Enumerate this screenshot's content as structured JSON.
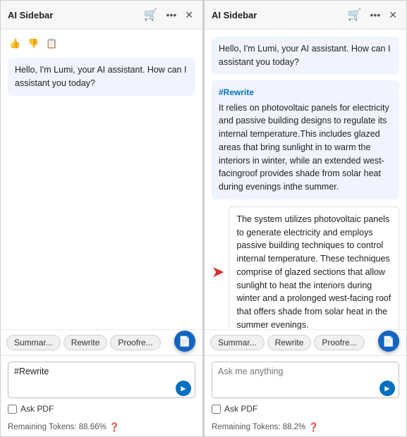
{
  "panels": [
    {
      "id": "left",
      "header": {
        "title": "AI Sidebar",
        "cart_icon": "🛒",
        "more_icon": "⋯",
        "close_icon": "✕"
      },
      "messages": [
        {
          "type": "ai-greeting",
          "text": "Hello, I'm Lumi, your AI assistant. How can I assistant you today?"
        }
      ],
      "quick_actions": [
        {
          "label": "Summar..."
        },
        {
          "label": "Rewrite"
        },
        {
          "label": "Proofre..."
        }
      ],
      "input": {
        "value": "#Rewrite\n",
        "placeholder": "Ask me anything"
      },
      "ask_pdf_label": "Ask PDF",
      "tokens_label": "Remaining Tokens: 88.66%"
    },
    {
      "id": "right",
      "header": {
        "title": "AI Sidebar",
        "cart_icon": "🛒",
        "more_icon": "⋯",
        "close_icon": "✕"
      },
      "messages": [
        {
          "type": "ai-greeting",
          "text": "Hello, I'm Lumi, your AI assistant. How can I assistant you today?"
        },
        {
          "type": "rewrite-original",
          "tag": "#Rewrite",
          "text": "It relies on photovoltaic panels for electricity and passive building designs to regulate its internal temperature.This includes glazed areas that bring sunlight in to warm the interiors in winter, while an extended west-facingroof provides shade from solar heat during evenings inthe summer."
        },
        {
          "type": "rewrite-result",
          "text": "The system utilizes photovoltaic panels to generate electricity and employs passive building techniques to control internal temperature. These techniques comprise of glazed sections that allow sunlight to heat the interiors during winter and a prolonged west-facing roof that offers shade from solar heat in the summer evenings."
        }
      ],
      "quick_actions": [
        {
          "label": "Summar..."
        },
        {
          "label": "Rewrite"
        },
        {
          "label": "Proofre..."
        }
      ],
      "input": {
        "value": "",
        "placeholder": "Ask me anything"
      },
      "ask_pdf_label": "Ask PDF",
      "tokens_label": "Remaining Tokens: 88.2%"
    }
  ]
}
